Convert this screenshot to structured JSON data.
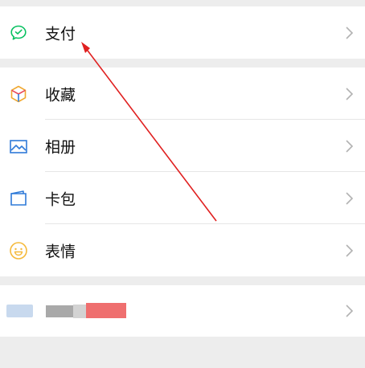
{
  "menu": {
    "pay": {
      "label": "支付",
      "icon": "wechat-pay-icon"
    },
    "favorites": {
      "label": "收藏",
      "icon": "cube-icon"
    },
    "album": {
      "label": "相册",
      "icon": "image-icon"
    },
    "cards": {
      "label": "卡包",
      "icon": "card-wallet-icon"
    },
    "stickers": {
      "label": "表情",
      "icon": "smiley-icon"
    }
  },
  "colors": {
    "pay_green": "#07c160",
    "annotation_red": "#e02020",
    "chevron": "#b2b2b2",
    "blue_icon": "#2f7ad8",
    "smiley_yellow": "#f5b93a"
  }
}
